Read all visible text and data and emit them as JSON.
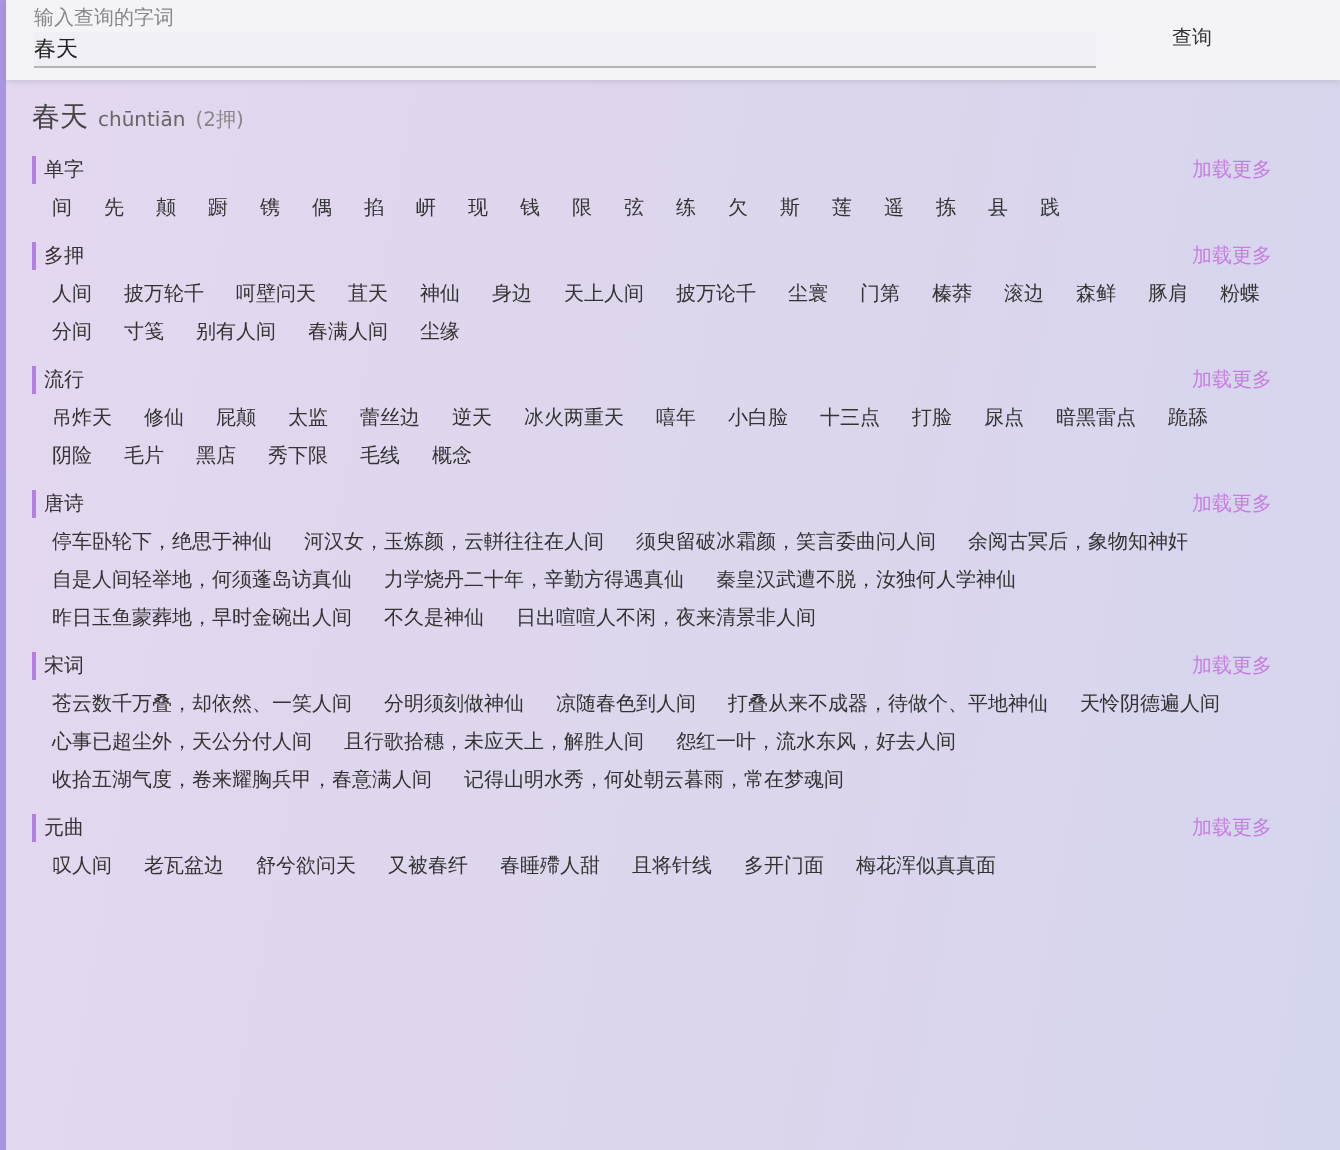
{
  "search": {
    "label": "输入查询的字词",
    "value": "春天",
    "button": "查询"
  },
  "heading": {
    "word": "春天",
    "pinyin": "chūntiān",
    "count": "(2押)"
  },
  "sections": [
    {
      "title": "单字",
      "more": "加载更多",
      "items": [
        "间",
        "先",
        "颠",
        "蹰",
        "镌",
        "偶",
        "掐",
        "岍",
        "现",
        "钱",
        "限",
        "弦",
        "练",
        "欠",
        "斯",
        "莲",
        "遥",
        "拣",
        "县",
        "践"
      ]
    },
    {
      "title": "多押",
      "more": "加载更多",
      "items": [
        "人间",
        "披万轮千",
        "呵壁问天",
        "苴天",
        "神仙",
        "身边",
        "天上人间",
        "披万论千",
        "尘寰",
        "门第",
        "榛莽",
        "滚边",
        "森鲜",
        "豚肩",
        "粉蝶",
        "分间",
        "寸笺",
        "别有人间",
        "春满人间",
        "尘缘"
      ]
    },
    {
      "title": "流行",
      "more": "加载更多",
      "items": [
        "吊炸天",
        "修仙",
        "屁颠",
        "太监",
        "蕾丝边",
        "逆天",
        "冰火两重天",
        "嘻年",
        "小白脸",
        "十三点",
        "打脸",
        "尿点",
        "暗黑雷点",
        "跪舔",
        "阴险",
        "毛片",
        "黑店",
        "秀下限",
        "毛线",
        "概念"
      ]
    },
    {
      "title": "唐诗",
      "more": "加载更多",
      "items": [
        "停车卧轮下，绝思于神仙",
        "河汉女，玉炼颜，云軿往往在人间",
        "须臾留破冰霜颜，笑言委曲问人间",
        "余阅古冥后，象物知神奸",
        "自是人间轻举地，何须蓬岛访真仙",
        "力学烧丹二十年，辛勤方得遇真仙",
        "秦皇汉武遭不脱，汝独何人学神仙",
        "昨日玉鱼蒙葬地，早时金碗出人间",
        "不久是神仙",
        "日出喧喧人不闲，夜来清景非人间"
      ]
    },
    {
      "title": "宋词",
      "more": "加载更多",
      "items": [
        "苍云数千万叠，却依然、一笑人间",
        "分明须刻做神仙",
        "凉随春色到人间",
        "打叠从来不成器，待做个、平地神仙",
        "天怜阴德遍人间",
        "心事已超尘外，天公分付人间",
        "且行歌拾穗，未应天上，解胜人间",
        "怨红一叶，流水东风，好去人间",
        "收拾五湖气度，卷来耀胸兵甲，春意满人间",
        "记得山明水秀，何处朝云暮雨，常在梦魂间"
      ]
    },
    {
      "title": "元曲",
      "more": "加载更多",
      "items": [
        "叹人间",
        "老瓦盆边",
        "舒兮欲问天",
        "又被春纤",
        "春睡殢人甜",
        "且将针线",
        "多开门面",
        "梅花浑似真真面"
      ]
    }
  ]
}
